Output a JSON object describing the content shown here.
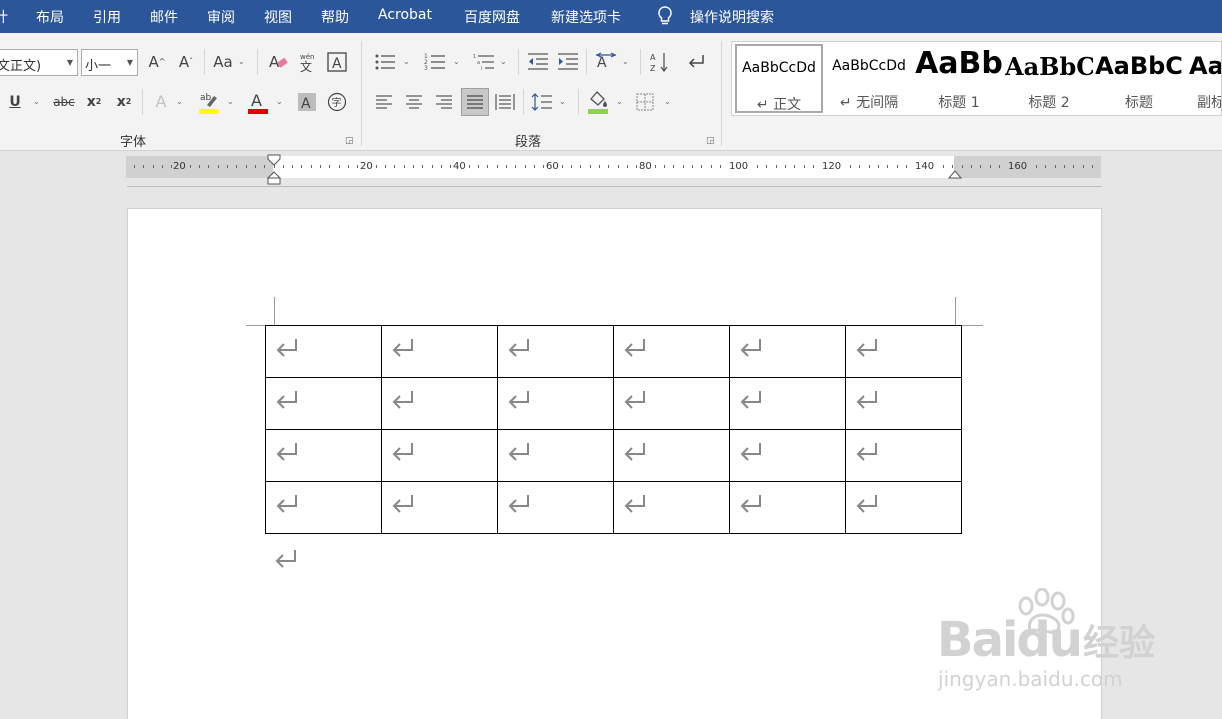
{
  "menu_tabs": [
    "计",
    "布局",
    "引用",
    "邮件",
    "审阅",
    "视图",
    "帮助",
    "Acrobat",
    "百度网盘",
    "新建选项卡"
  ],
  "tell_me": "操作说明搜索",
  "font": {
    "name": "文正文)",
    "size": "小一",
    "group_label": "字体"
  },
  "paragraph": {
    "group_label": "段落"
  },
  "styles": [
    {
      "sample": "AaBbCcDd",
      "name": "↵ 正文"
    },
    {
      "sample": "AaBbCcDd",
      "name": "↵ 无间隔"
    },
    {
      "sample": "AaBb",
      "name": "标题 1"
    },
    {
      "sample": "AaBbC",
      "name": "标题 2"
    },
    {
      "sample": "AaBbC",
      "name": "标题"
    },
    {
      "sample": "AaI",
      "name": "副标"
    }
  ],
  "ruler_labels": [
    "20",
    "20",
    "40",
    "60",
    "80",
    "100",
    "120",
    "140",
    "160"
  ],
  "table": {
    "rows": 4,
    "cols": 6
  },
  "watermark": {
    "brand": "Baidu",
    "cn": "经验",
    "url": "jingyan.baidu.com"
  },
  "colors": {
    "titlebar": "#2b579a",
    "highlight": "#ffff00",
    "font_color": "#e00000",
    "shading": "#92d050"
  }
}
